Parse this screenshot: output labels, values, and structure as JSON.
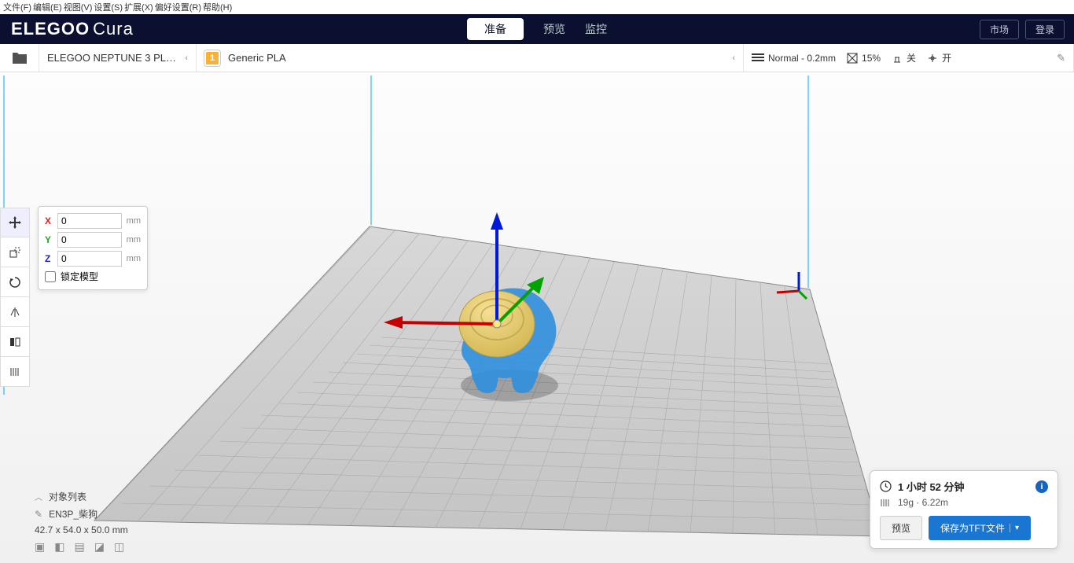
{
  "menu": {
    "file": "文件(F)",
    "edit": "编辑(E)",
    "view": "视图(V)",
    "settings": "设置(S)",
    "extensions": "扩展(X)",
    "preferences": "偏好设置(R)",
    "help": "帮助(H)"
  },
  "brand": {
    "a": "ELEGOO",
    "b": "Cura"
  },
  "stages": {
    "prepare": "准备",
    "preview": "预览",
    "monitor": "监控"
  },
  "top_right": {
    "marketplace": "市场",
    "signin": "登录"
  },
  "printer": {
    "name": "ELEGOO NEPTUNE 3 PL…"
  },
  "material": {
    "badge": "1",
    "name": "Generic PLA"
  },
  "print_settings": {
    "profile": "Normal - 0.2mm",
    "infill": "15%",
    "support_label": "关",
    "adhesion_label": "开"
  },
  "move_panel": {
    "x": "0",
    "y": "0",
    "z": "0",
    "unit": "mm",
    "lock": "锁定模型"
  },
  "objects": {
    "title": "对象列表",
    "name": "EN3P_柴狗",
    "dims": "42.7 x 54.0 x 50.0 mm"
  },
  "slice": {
    "time": "1 小时 52 分钟",
    "material": "19g · 6.22m",
    "preview_btn": "预览",
    "save_btn": "保存为TFT文件"
  }
}
